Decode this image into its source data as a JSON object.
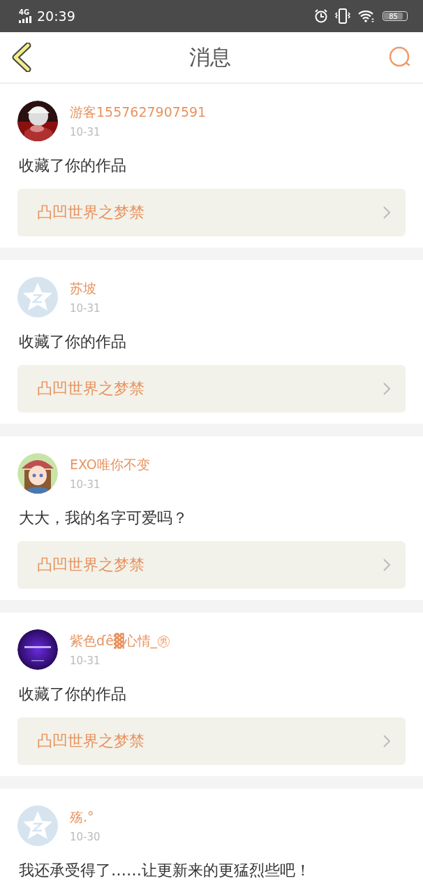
{
  "status_bar": {
    "network": "4G",
    "time": "20:39",
    "battery": "85"
  },
  "header": {
    "title": "消息"
  },
  "messages": [
    {
      "kind": "picture",
      "name": "游客1557627907591",
      "date": "10-31",
      "text": "收藏了你的作品",
      "link": "凸凹世界之梦禁"
    },
    {
      "kind": "default",
      "name": "苏坡",
      "date": "10-31",
      "text": "收藏了你的作品",
      "link": "凸凹世界之梦禁"
    },
    {
      "kind": "picture",
      "name": "EXO唯你不变",
      "date": "10-31",
      "text": "大大，我的名字可爱吗？",
      "link": "凸凹世界之梦禁"
    },
    {
      "kind": "picture",
      "name": "紫色ɗê▓心情_㊚",
      "date": "10-31",
      "text": "收藏了你的作品",
      "link": "凸凹世界之梦禁"
    },
    {
      "kind": "default",
      "name": "殇.°",
      "date": "10-30",
      "text": "我还承受得了……让更新来的更猛烈些吧！"
    }
  ]
}
